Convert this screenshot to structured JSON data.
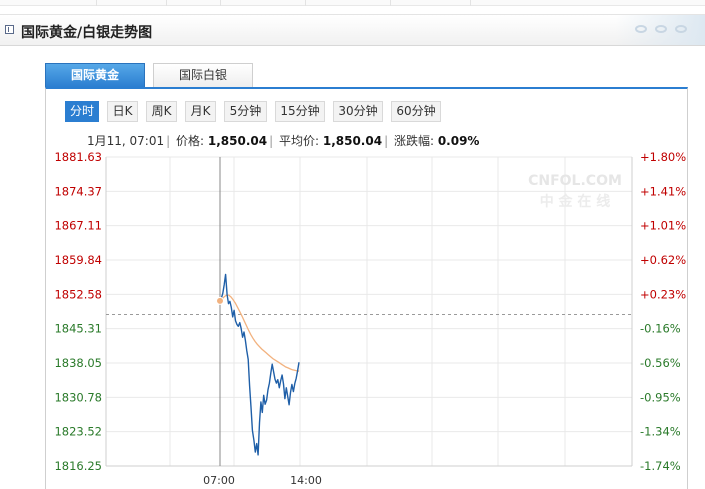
{
  "page": {
    "title": "国际黄金/白银走势图"
  },
  "tabs": [
    {
      "label": "国际黄金",
      "active": true
    },
    {
      "label": "国际白银",
      "active": false
    }
  ],
  "periods": [
    "分时",
    "日K",
    "周K",
    "月K",
    "5分钟",
    "15分钟",
    "30分钟",
    "60分钟"
  ],
  "active_period": "分时",
  "info": {
    "datetime": "1月11, 07:01",
    "price_label": "价格:",
    "price": "1,850.04",
    "avg_label": "平均价:",
    "avg": "1,850.04",
    "change_label": "涨跌幅:",
    "change": "0.09%"
  },
  "watermark": {
    "line1": "CNFOL.COM",
    "line2": "中 金 在 线"
  },
  "colors": {
    "accent": "#2b7ed1",
    "price_line": "#1f5fa8",
    "avg_line": "#f2b27f",
    "up_label": "#c00000",
    "down_label": "#2a7a2a",
    "ref_line": "#9a9a9a"
  },
  "chart_data": {
    "type": "line",
    "title": "",
    "xlabel": "",
    "ylabel": "",
    "ylim": [
      1816.25,
      1881.63
    ],
    "y_ticks": [
      "1881.63",
      "1874.37",
      "1867.11",
      "1859.84",
      "1852.58",
      "1845.31",
      "1838.05",
      "1830.78",
      "1823.52",
      "1816.25"
    ],
    "right_ticks": [
      "+1.80%",
      "+1.41%",
      "+1.01%",
      "+0.62%",
      "+0.23%",
      "-0.16%",
      "-0.56%",
      "-0.95%",
      "-1.34%",
      "-1.74%"
    ],
    "x_ticks": [
      "07:00",
      "14:00"
    ],
    "reference_price": 1848.3,
    "grid": true,
    "series": [
      {
        "values": [
          1851.2,
          1851.8,
          1852.8,
          1854.6,
          1856.8,
          1852.5,
          1850.6,
          1851.1,
          1849.8,
          1847.8,
          1849.2,
          1847.0,
          1846.2,
          1845.8,
          1846.6,
          1845.3,
          1843.5,
          1844.6,
          1842.8,
          1840.6,
          1838.8,
          1833.2,
          1828.7,
          1823.8,
          1821.7,
          1819.2,
          1821.0,
          1818.6,
          1825.4,
          1829.8,
          1827.6,
          1831.2,
          1829.3,
          1830.2,
          1832.4,
          1833.8,
          1835.9,
          1837.8,
          1836.2,
          1834.6,
          1833.8,
          1834.5,
          1832.8,
          1834.3,
          1835.5,
          1833.6,
          1830.5,
          1832.8,
          1831.0,
          1829.2,
          1831.8,
          1833.5,
          1832.0,
          1833.7,
          1834.8,
          1836.4,
          1838.2
        ]
      },
      {
        "values": [
          1851.2,
          1851.6,
          1852.1,
          1852.4,
          1852.4,
          1852.0,
          1851.4,
          1850.7,
          1849.8,
          1848.9,
          1848.0,
          1847.0,
          1846.0,
          1845.0,
          1844.1,
          1843.3,
          1842.6,
          1842.0,
          1841.5,
          1841.0,
          1840.6,
          1840.2,
          1839.8,
          1839.4,
          1839.0,
          1838.7,
          1838.4,
          1838.1,
          1837.8,
          1837.5,
          1837.2,
          1837.0,
          1836.8,
          1836.6,
          1836.5,
          1836.4,
          1836.3
        ]
      }
    ]
  }
}
